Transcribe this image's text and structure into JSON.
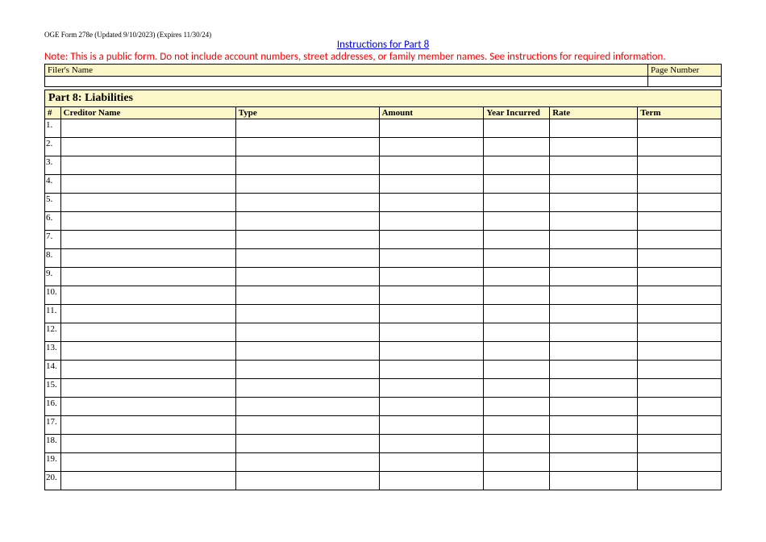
{
  "form_id": "OGE Form 278e (Updated 9/10/2023) (Expires 11/30/24)",
  "instructions_link": "Instructions for Part 8",
  "note": "Note: This is a public form. Do not include account numbers, street addresses, or family member names.  See instructions for required information.",
  "filer_name_label": "Filer's Name",
  "page_number_label": "Page Number",
  "filer_name_value": "",
  "page_number_value": "",
  "section_title": "Part 8: Liabilities",
  "headers": {
    "num": "#",
    "creditor": "Creditor Name",
    "type": "Type",
    "amount": "Amount",
    "year": "Year Incurred",
    "rate": "Rate",
    "term": "Term"
  },
  "rows": [
    {
      "n": "1.",
      "creditor": "",
      "type": "",
      "amount": "",
      "year": "",
      "rate": "",
      "term": ""
    },
    {
      "n": "2.",
      "creditor": "",
      "type": "",
      "amount": "",
      "year": "",
      "rate": "",
      "term": ""
    },
    {
      "n": "3.",
      "creditor": "",
      "type": "",
      "amount": "",
      "year": "",
      "rate": "",
      "term": ""
    },
    {
      "n": "4.",
      "creditor": "",
      "type": "",
      "amount": "",
      "year": "",
      "rate": "",
      "term": ""
    },
    {
      "n": "5.",
      "creditor": "",
      "type": "",
      "amount": "",
      "year": "",
      "rate": "",
      "term": ""
    },
    {
      "n": "6.",
      "creditor": "",
      "type": "",
      "amount": "",
      "year": "",
      "rate": "",
      "term": ""
    },
    {
      "n": "7.",
      "creditor": "",
      "type": "",
      "amount": "",
      "year": "",
      "rate": "",
      "term": ""
    },
    {
      "n": "8.",
      "creditor": "",
      "type": "",
      "amount": "",
      "year": "",
      "rate": "",
      "term": ""
    },
    {
      "n": "9.",
      "creditor": "",
      "type": "",
      "amount": "",
      "year": "",
      "rate": "",
      "term": ""
    },
    {
      "n": "10.",
      "creditor": "",
      "type": "",
      "amount": "",
      "year": "",
      "rate": "",
      "term": ""
    },
    {
      "n": "11.",
      "creditor": "",
      "type": "",
      "amount": "",
      "year": "",
      "rate": "",
      "term": ""
    },
    {
      "n": "12.",
      "creditor": "",
      "type": "",
      "amount": "",
      "year": "",
      "rate": "",
      "term": ""
    },
    {
      "n": "13.",
      "creditor": "",
      "type": "",
      "amount": "",
      "year": "",
      "rate": "",
      "term": ""
    },
    {
      "n": "14.",
      "creditor": "",
      "type": "",
      "amount": "",
      "year": "",
      "rate": "",
      "term": ""
    },
    {
      "n": "15.",
      "creditor": "",
      "type": "",
      "amount": "",
      "year": "",
      "rate": "",
      "term": ""
    },
    {
      "n": "16.",
      "creditor": "",
      "type": "",
      "amount": "",
      "year": "",
      "rate": "",
      "term": ""
    },
    {
      "n": "17.",
      "creditor": "",
      "type": "",
      "amount": "",
      "year": "",
      "rate": "",
      "term": ""
    },
    {
      "n": "18.",
      "creditor": "",
      "type": "",
      "amount": "",
      "year": "",
      "rate": "",
      "term": ""
    },
    {
      "n": "19.",
      "creditor": "",
      "type": "",
      "amount": "",
      "year": "",
      "rate": "",
      "term": ""
    },
    {
      "n": "20.",
      "creditor": "",
      "type": "",
      "amount": "",
      "year": "",
      "rate": "",
      "term": ""
    }
  ]
}
